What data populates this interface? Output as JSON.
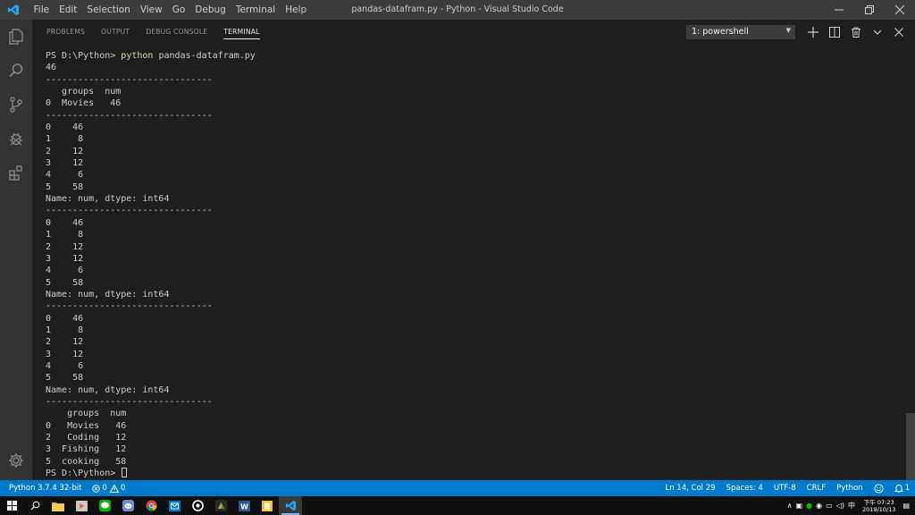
{
  "window": {
    "title": "pandas-datafram.py - Python - Visual Studio Code",
    "menu": [
      "File",
      "Edit",
      "Selection",
      "View",
      "Go",
      "Debug",
      "Terminal",
      "Help"
    ]
  },
  "activity_bar": {
    "icons": [
      "explorer-icon",
      "search-icon",
      "source-control-icon",
      "debug-icon",
      "extensions-icon"
    ],
    "settings": "gear-icon"
  },
  "panel": {
    "tabs": [
      "PROBLEMS",
      "OUTPUT",
      "DEBUG CONSOLE",
      "TERMINAL"
    ],
    "active_tab": "TERMINAL",
    "terminal_select": "1: powershell"
  },
  "terminal": {
    "prompt": "PS D:\\Python> ",
    "command": "python",
    "command_args": " pandas-datafram.py",
    "output_lines": [
      "46",
      "-------------------------------",
      "   groups  num",
      "0  Movies   46",
      "-------------------------------",
      "0    46",
      "1     8",
      "2    12",
      "3    12",
      "4     6",
      "5    58",
      "Name: num, dtype: int64",
      "-------------------------------",
      "0    46",
      "1     8",
      "2    12",
      "3    12",
      "4     6",
      "5    58",
      "Name: num, dtype: int64",
      "-------------------------------",
      "0    46",
      "1     8",
      "2    12",
      "3    12",
      "4     6",
      "5    58",
      "Name: num, dtype: int64",
      "-------------------------------",
      "    groups  num",
      "0   Movies   46",
      "2   Coding   12",
      "3  Fishing   12",
      "5  cooking   58"
    ],
    "final_prompt": "PS D:\\Python> "
  },
  "status_bar": {
    "interpreter": "Python 3.7.4 32-bit",
    "errors": "0",
    "warnings": "0",
    "position": "Ln 14, Col 29",
    "spaces": "Spaces: 4",
    "encoding": "UTF-8",
    "eol": "CRLF",
    "language": "Python",
    "notifications": "1"
  },
  "taskbar": {
    "clock_line1": "下午 07:23",
    "clock_line2": "2019/10/13"
  },
  "colors": {
    "accent": "#007acc",
    "titlebar": "#3c3c3c",
    "activitybar": "#333333",
    "editor_bg": "#1e1e1e",
    "command": "#dcdcaa"
  }
}
